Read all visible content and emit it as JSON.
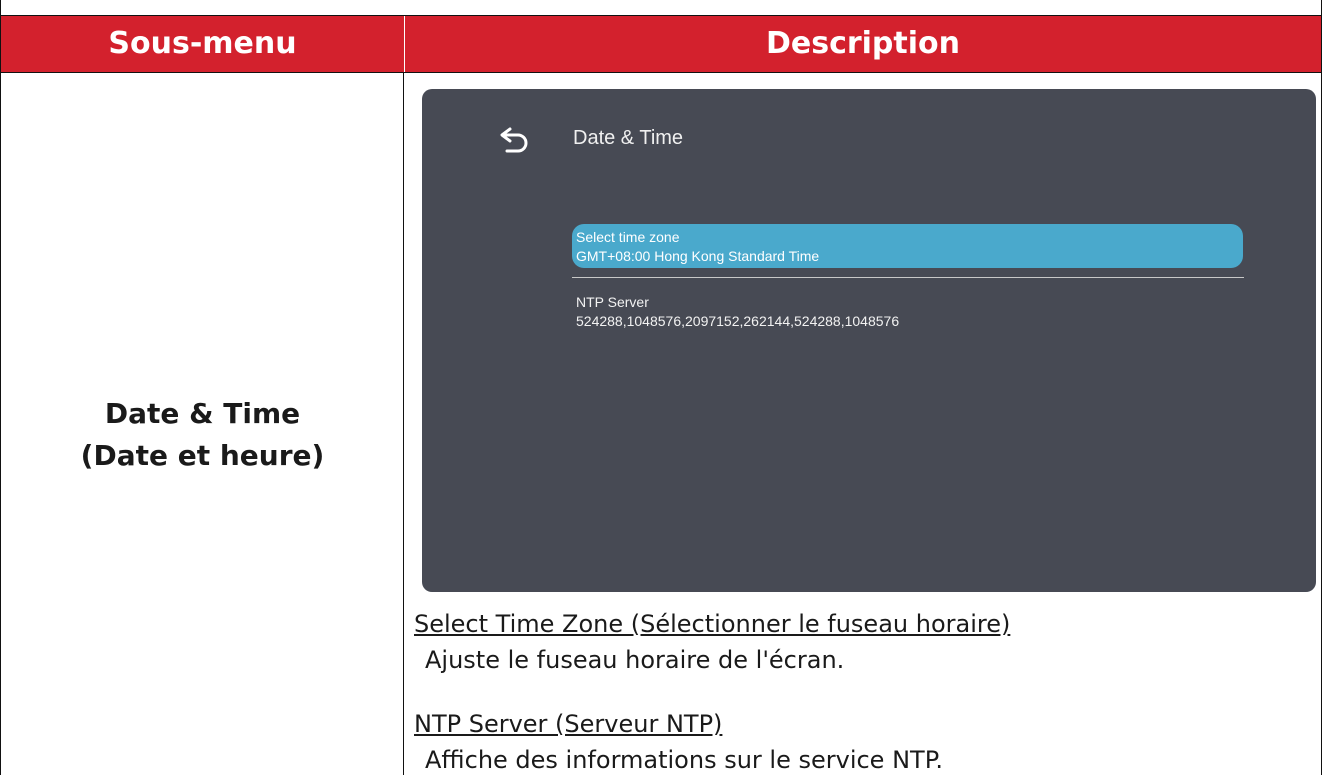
{
  "table": {
    "header_left": "Sous-menu",
    "header_right": "Description",
    "row_label_line1": "Date & Time",
    "row_label_line2": "(Date et heure)"
  },
  "screen": {
    "title": "Date & Time",
    "back_icon": "back-arrow-icon",
    "items": [
      {
        "label": "Select time zone",
        "value": "GMT+08:00 Hong Kong Standard Time",
        "selected": true
      },
      {
        "label": "NTP Server",
        "value": "524288,1048576,2097152,262144,524288,1048576",
        "selected": false
      }
    ],
    "colors": {
      "panel_bg": "#474a54",
      "highlight": "#4aa9cc"
    }
  },
  "descriptions": [
    {
      "heading": "Select Time Zone (Sélectionner le fuseau horaire)",
      "text": "Ajuste le fuseau horaire de l'écran."
    },
    {
      "heading": "NTP Server (Serveur NTP)",
      "text": "Affiche des informations sur le service NTP."
    }
  ],
  "colors": {
    "header_bg": "#d3212d",
    "header_text": "#ffffff"
  }
}
